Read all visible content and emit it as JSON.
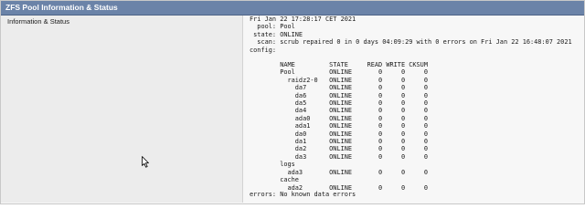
{
  "panel": {
    "title": "ZFS Pool Information & Status"
  },
  "row": {
    "label": "Information & Status"
  },
  "status": {
    "header_text": "Fri Jan 22 17:28:17 CET 2021\n  pool: Pool\n state: ONLINE\n  scan: scrub repaired 0 in 0 days 04:09:29 with 0 errors on Fri Jan 22 16:48:07 2021\nconfig:",
    "config_text": "        NAME         STATE     READ WRITE CKSUM\n        Pool         ONLINE       0     0     0\n          raidz2-0   ONLINE       0     0     0\n            da7      ONLINE       0     0     0\n            da6      ONLINE       0     0     0\n            da5      ONLINE       0     0     0\n            da4      ONLINE       0     0     0\n            ada0     ONLINE       0     0     0\n            ada1     ONLINE       0     0     0\n            da0      ONLINE       0     0     0\n            da1      ONLINE       0     0     0\n            da2      ONLINE       0     0     0\n            da3      ONLINE       0     0     0\n        logs\n          ada3       ONLINE       0     0     0\n        cache\n          ada2       ONLINE       0     0     0",
    "errors_text": "errors: No known data errors"
  },
  "colors": {
    "header_bg": "#6b83a8",
    "label_bg": "#ececec",
    "value_bg": "#f7f7f7"
  },
  "icons": {
    "cursor": "mouse-pointer-icon"
  }
}
